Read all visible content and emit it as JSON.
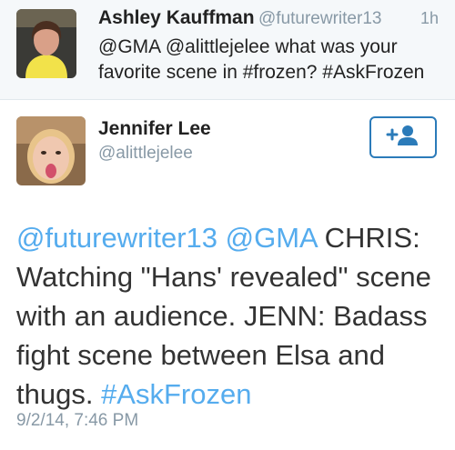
{
  "reply_tweet": {
    "author_name": "Ashley Kauffman",
    "author_handle": "@futurewriter13",
    "time_ago": "1h",
    "text_line1": "@GMA @alittlejelee what was your",
    "text_line2": "favorite scene in #frozen? #AskFrozen"
  },
  "main_tweet": {
    "author_name": "Jennifer Lee",
    "author_handle": "@alittlejelee",
    "follow_icon": "add-user-icon",
    "mention_1": "@futurewriter13",
    "mention_2": "@GMA",
    "text_body": " CHRIS: Watching \"Hans' revealed\" scene with an audience. JENN: Badass fight scene between Elsa and thugs. ",
    "hashtag": "#AskFrozen",
    "timestamp": "9/2/14, 7:46 PM"
  },
  "colors": {
    "link": "#55acee",
    "follow_border": "#2b7bb9",
    "reply_background": "#f5f8fa"
  }
}
